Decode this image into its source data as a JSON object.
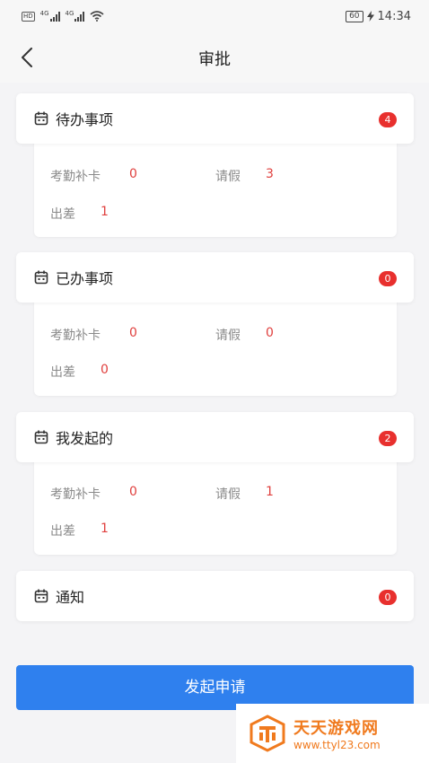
{
  "status_bar": {
    "network_a": "4G",
    "network_b": "4G",
    "battery": "60",
    "time": "14:34"
  },
  "header": {
    "title": "审批"
  },
  "sections": [
    {
      "title": "待办事项",
      "badge": "4",
      "stats": {
        "attendance_label": "考勤补卡",
        "attendance_value": "0",
        "leave_label": "请假",
        "leave_value": "3",
        "trip_label": "出差",
        "trip_value": "1"
      }
    },
    {
      "title": "已办事项",
      "badge": "0",
      "stats": {
        "attendance_label": "考勤补卡",
        "attendance_value": "0",
        "leave_label": "请假",
        "leave_value": "0",
        "trip_label": "出差",
        "trip_value": "0"
      }
    },
    {
      "title": "我发起的",
      "badge": "2",
      "stats": {
        "attendance_label": "考勤补卡",
        "attendance_value": "0",
        "leave_label": "请假",
        "leave_value": "1",
        "trip_label": "出差",
        "trip_value": "1"
      }
    },
    {
      "title": "通知",
      "badge": "0"
    }
  ],
  "submit_button": "发起申请",
  "watermark": {
    "name": "天天游戏网",
    "url": "www.ttyl23.com"
  },
  "colors": {
    "accent": "#2f80ee",
    "badge": "#e8302e",
    "value": "#e0403e",
    "watermark": "#f07a1e"
  },
  "icons": {
    "back": "chevron-left-icon",
    "section": "calendar-icon",
    "wifi": "wifi-icon",
    "signal": "signal-icon",
    "battery": "battery-icon",
    "charging": "lightning-icon"
  }
}
